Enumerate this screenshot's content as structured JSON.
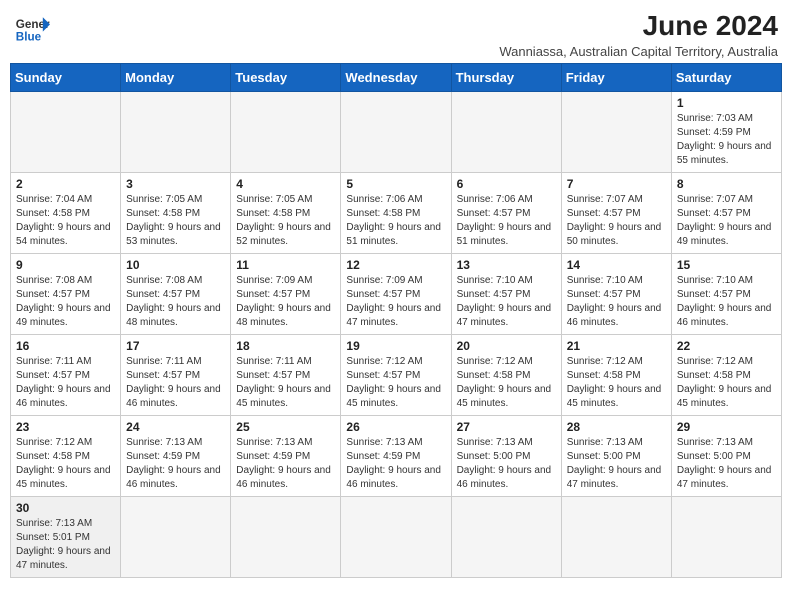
{
  "header": {
    "logo_text_general": "General",
    "logo_text_blue": "Blue",
    "month_year": "June 2024",
    "location": "Wanniassa, Australian Capital Territory, Australia"
  },
  "days_of_week": [
    "Sunday",
    "Monday",
    "Tuesday",
    "Wednesday",
    "Thursday",
    "Friday",
    "Saturday"
  ],
  "weeks": [
    [
      {
        "day": "",
        "info": ""
      },
      {
        "day": "",
        "info": ""
      },
      {
        "day": "",
        "info": ""
      },
      {
        "day": "",
        "info": ""
      },
      {
        "day": "",
        "info": ""
      },
      {
        "day": "",
        "info": ""
      },
      {
        "day": "1",
        "info": "Sunrise: 7:03 AM\nSunset: 4:59 PM\nDaylight: 9 hours and 55 minutes."
      }
    ],
    [
      {
        "day": "2",
        "info": "Sunrise: 7:04 AM\nSunset: 4:58 PM\nDaylight: 9 hours and 54 minutes."
      },
      {
        "day": "3",
        "info": "Sunrise: 7:05 AM\nSunset: 4:58 PM\nDaylight: 9 hours and 53 minutes."
      },
      {
        "day": "4",
        "info": "Sunrise: 7:05 AM\nSunset: 4:58 PM\nDaylight: 9 hours and 52 minutes."
      },
      {
        "day": "5",
        "info": "Sunrise: 7:06 AM\nSunset: 4:58 PM\nDaylight: 9 hours and 51 minutes."
      },
      {
        "day": "6",
        "info": "Sunrise: 7:06 AM\nSunset: 4:57 PM\nDaylight: 9 hours and 51 minutes."
      },
      {
        "day": "7",
        "info": "Sunrise: 7:07 AM\nSunset: 4:57 PM\nDaylight: 9 hours and 50 minutes."
      },
      {
        "day": "8",
        "info": "Sunrise: 7:07 AM\nSunset: 4:57 PM\nDaylight: 9 hours and 49 minutes."
      }
    ],
    [
      {
        "day": "9",
        "info": "Sunrise: 7:08 AM\nSunset: 4:57 PM\nDaylight: 9 hours and 49 minutes."
      },
      {
        "day": "10",
        "info": "Sunrise: 7:08 AM\nSunset: 4:57 PM\nDaylight: 9 hours and 48 minutes."
      },
      {
        "day": "11",
        "info": "Sunrise: 7:09 AM\nSunset: 4:57 PM\nDaylight: 9 hours and 48 minutes."
      },
      {
        "day": "12",
        "info": "Sunrise: 7:09 AM\nSunset: 4:57 PM\nDaylight: 9 hours and 47 minutes."
      },
      {
        "day": "13",
        "info": "Sunrise: 7:10 AM\nSunset: 4:57 PM\nDaylight: 9 hours and 47 minutes."
      },
      {
        "day": "14",
        "info": "Sunrise: 7:10 AM\nSunset: 4:57 PM\nDaylight: 9 hours and 46 minutes."
      },
      {
        "day": "15",
        "info": "Sunrise: 7:10 AM\nSunset: 4:57 PM\nDaylight: 9 hours and 46 minutes."
      }
    ],
    [
      {
        "day": "16",
        "info": "Sunrise: 7:11 AM\nSunset: 4:57 PM\nDaylight: 9 hours and 46 minutes."
      },
      {
        "day": "17",
        "info": "Sunrise: 7:11 AM\nSunset: 4:57 PM\nDaylight: 9 hours and 46 minutes."
      },
      {
        "day": "18",
        "info": "Sunrise: 7:11 AM\nSunset: 4:57 PM\nDaylight: 9 hours and 45 minutes."
      },
      {
        "day": "19",
        "info": "Sunrise: 7:12 AM\nSunset: 4:57 PM\nDaylight: 9 hours and 45 minutes."
      },
      {
        "day": "20",
        "info": "Sunrise: 7:12 AM\nSunset: 4:58 PM\nDaylight: 9 hours and 45 minutes."
      },
      {
        "day": "21",
        "info": "Sunrise: 7:12 AM\nSunset: 4:58 PM\nDaylight: 9 hours and 45 minutes."
      },
      {
        "day": "22",
        "info": "Sunrise: 7:12 AM\nSunset: 4:58 PM\nDaylight: 9 hours and 45 minutes."
      }
    ],
    [
      {
        "day": "23",
        "info": "Sunrise: 7:12 AM\nSunset: 4:58 PM\nDaylight: 9 hours and 45 minutes."
      },
      {
        "day": "24",
        "info": "Sunrise: 7:13 AM\nSunset: 4:59 PM\nDaylight: 9 hours and 46 minutes."
      },
      {
        "day": "25",
        "info": "Sunrise: 7:13 AM\nSunset: 4:59 PM\nDaylight: 9 hours and 46 minutes."
      },
      {
        "day": "26",
        "info": "Sunrise: 7:13 AM\nSunset: 4:59 PM\nDaylight: 9 hours and 46 minutes."
      },
      {
        "day": "27",
        "info": "Sunrise: 7:13 AM\nSunset: 5:00 PM\nDaylight: 9 hours and 46 minutes."
      },
      {
        "day": "28",
        "info": "Sunrise: 7:13 AM\nSunset: 5:00 PM\nDaylight: 9 hours and 47 minutes."
      },
      {
        "day": "29",
        "info": "Sunrise: 7:13 AM\nSunset: 5:00 PM\nDaylight: 9 hours and 47 minutes."
      }
    ],
    [
      {
        "day": "30",
        "info": "Sunrise: 7:13 AM\nSunset: 5:01 PM\nDaylight: 9 hours and 47 minutes."
      },
      {
        "day": "",
        "info": ""
      },
      {
        "day": "",
        "info": ""
      },
      {
        "day": "",
        "info": ""
      },
      {
        "day": "",
        "info": ""
      },
      {
        "day": "",
        "info": ""
      },
      {
        "day": "",
        "info": ""
      }
    ]
  ]
}
